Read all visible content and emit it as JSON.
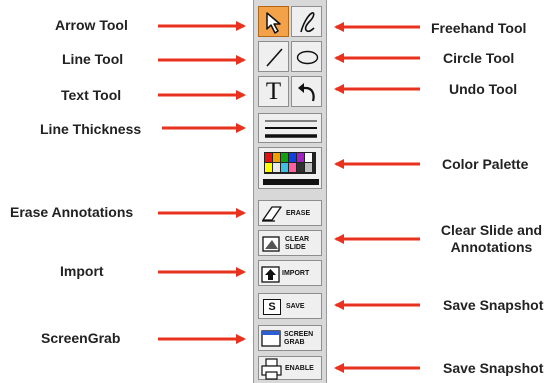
{
  "labels_left": {
    "arrow_tool": "Arrow Tool",
    "line_tool": "Line Tool",
    "text_tool": "Text Tool",
    "line_thickness": "Line Thickness",
    "erase_annotations": "Erase Annotations",
    "import": "Import",
    "screengrab": "ScreenGrab"
  },
  "labels_right": {
    "freehand_tool": "Freehand Tool",
    "circle_tool": "Circle Tool",
    "undo_tool": "Undo Tool",
    "color_palette": "Color Palette",
    "clear_slide_line1": "Clear Slide and",
    "clear_slide_line2": "Annotations",
    "save_snapshot_1": "Save Snapshot",
    "save_snapshot_2": "Save Snapshot"
  },
  "toolbar": {
    "text_glyph": "T",
    "erase": "ERASE",
    "clear_line1": "CLEAR",
    "clear_line2": "SLIDE",
    "import": "IMPORT",
    "save_glyph": "S",
    "save": "SAVE",
    "screen_line1": "SCREEN",
    "screen_line2": "GRAB",
    "enable": "ENABLE"
  },
  "colors": {
    "arrow": "#e8321e",
    "selected_tool": "#f3a24a",
    "palette": [
      "#e01010",
      "#f0a000",
      "#10a010",
      "#1040e0",
      "#a020c0",
      "#ffffff",
      "#ffff00",
      "#e8e8e8",
      "#40c0e0",
      "#ff60a0",
      "#303030",
      "#c0c0c0"
    ]
  }
}
